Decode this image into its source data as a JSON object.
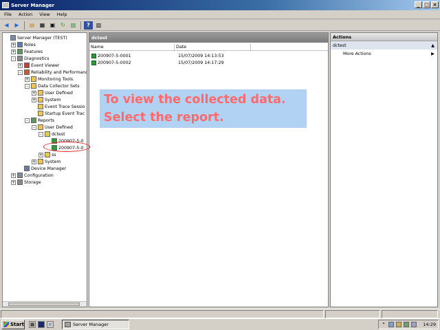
{
  "window": {
    "title": "Server Manager"
  },
  "menu": [
    "File",
    "Action",
    "View",
    "Help"
  ],
  "toolbar": {
    "icons": [
      "back-icon",
      "forward-icon",
      "up-icon",
      "show-hide-tree-icon",
      "properties-icon",
      "refresh-icon",
      "export-icon",
      "help-icon",
      "view-icon"
    ]
  },
  "tree": {
    "items": [
      {
        "label": "Server Manager (TEST)",
        "level": 0,
        "expander": "",
        "icon": "server-icon",
        "icon_color": "#7a8aa8"
      },
      {
        "label": "Roles",
        "level": 1,
        "expander": "+",
        "icon": "roles-icon",
        "icon_color": "#5a7ac0"
      },
      {
        "label": "Features",
        "level": 1,
        "expander": "+",
        "icon": "features-icon",
        "icon_color": "#5a9a5a"
      },
      {
        "label": "Diagnostics",
        "level": 1,
        "expander": "-",
        "icon": "diagnostics-icon",
        "icon_color": "#8a8a8a"
      },
      {
        "label": "Event Viewer",
        "level": 2,
        "expander": "+",
        "icon": "event-viewer-icon",
        "icon_color": "#c04040"
      },
      {
        "label": "Reliability and Performance",
        "level": 2,
        "expander": "-",
        "icon": "performance-icon",
        "icon_color": "#c06030"
      },
      {
        "label": "Monitoring Tools",
        "level": 3,
        "expander": "+",
        "icon": "folder-icon",
        "icon_color": "#e8c850"
      },
      {
        "label": "Data Collector Sets",
        "level": 3,
        "expander": "-",
        "icon": "folder-icon",
        "icon_color": "#e8c850"
      },
      {
        "label": "User Defined",
        "level": 4,
        "expander": "+",
        "icon": "folder-icon",
        "icon_color": "#e8c850"
      },
      {
        "label": "System",
        "level": 4,
        "expander": "+",
        "icon": "folder-icon",
        "icon_color": "#e8c850"
      },
      {
        "label": "Event Trace Sessio",
        "level": 4,
        "expander": "",
        "icon": "folder-icon",
        "icon_color": "#e8c850"
      },
      {
        "label": "Startup Event Trac",
        "level": 4,
        "expander": "",
        "icon": "folder-icon",
        "icon_color": "#e8c850"
      },
      {
        "label": "Reports",
        "level": 3,
        "expander": "-",
        "icon": "reports-icon",
        "icon_color": "#5a9a5a"
      },
      {
        "label": "User Defined",
        "level": 4,
        "expander": "-",
        "icon": "folder-icon",
        "icon_color": "#e8c850"
      },
      {
        "label": "dctest",
        "level": 5,
        "expander": "-",
        "icon": "folder-icon",
        "icon_color": "#e8c850"
      },
      {
        "label": "200907-5-0",
        "level": 6,
        "expander": "",
        "icon": "report-icon",
        "icon_color": "#2d9b3a"
      },
      {
        "label": "200907-5-0",
        "level": 6,
        "expander": "",
        "icon": "report-icon",
        "icon_color": "#2d9b3a"
      },
      {
        "label": "ss",
        "level": 5,
        "expander": "+",
        "icon": "folder-icon",
        "icon_color": "#e8c850"
      },
      {
        "label": "System",
        "level": 4,
        "expander": "+",
        "icon": "folder-icon",
        "icon_color": "#e8c850"
      },
      {
        "label": "Device Manager",
        "level": 2,
        "expander": "",
        "icon": "device-manager-icon",
        "icon_color": "#6a7aa0"
      },
      {
        "label": "Configuration",
        "level": 1,
        "expander": "+",
        "icon": "configuration-icon",
        "icon_color": "#7a8a9a"
      },
      {
        "label": "Storage",
        "level": 1,
        "expander": "+",
        "icon": "storage-icon",
        "icon_color": "#8a8a8a"
      }
    ]
  },
  "center": {
    "header": "dctest",
    "columns": [
      "Name",
      "Date"
    ],
    "rows": [
      {
        "name": "200907-5-0001",
        "date": "15/07/2009 14:13:53"
      },
      {
        "name": "200907-5-0002",
        "date": "15/07/2009 14:17:29"
      }
    ]
  },
  "actions": {
    "header": "Actions",
    "section": "dctest",
    "items": [
      "More Actions"
    ]
  },
  "callout": {
    "line1": "To view the collected data.",
    "line2": "Select the report."
  },
  "taskbar": {
    "start": "Start",
    "task": "Server Manager",
    "clock": "14:29"
  },
  "colors": {
    "title_gradient_start": "#0a246a",
    "callout_bg": "#b2d2f4",
    "callout_text": "#ff6a6a",
    "highlight": "#e02020"
  }
}
